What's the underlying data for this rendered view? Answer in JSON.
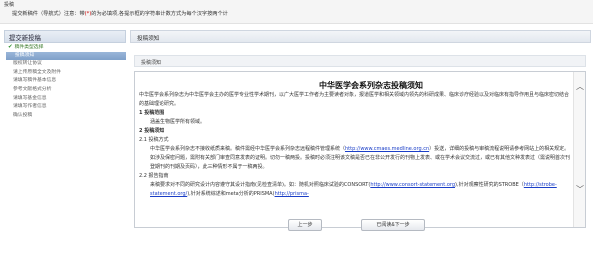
{
  "header": {
    "title": "投稿",
    "instruction_prefix": "提交新稿件（导航式）注意：带",
    "required_mark": "(*)",
    "instruction_suffix": "的为必填项,各提示框的字符串计数方式为每个汉字按两个计"
  },
  "sidebar": {
    "title": "提交新投稿",
    "items": [
      {
        "label": "稿件类型选择",
        "state": "done"
      },
      {
        "label": "投稿须知",
        "state": "active"
      },
      {
        "label": "版权转让协议",
        "state": "pending"
      },
      {
        "label": "请上传原稿全文及附件",
        "state": "pending"
      },
      {
        "label": "请填写稿件基本信息",
        "state": "pending"
      },
      {
        "label": "参考文献格式分析",
        "state": "pending"
      },
      {
        "label": "请填写基金信息",
        "state": "pending"
      },
      {
        "label": "请填写作者信息",
        "state": "pending"
      },
      {
        "label": "确认投稿",
        "state": "pending"
      }
    ]
  },
  "main": {
    "title": "投稿须知",
    "subtitle": "投稿须知"
  },
  "doc": {
    "title": "中华医学会系列杂志投稿须知",
    "intro": "中华医学会系列杂志为中华医学会主办的医学专业性学术期刊，以广大医学工作者为主要读者对象，报道医学和相关领域内领先的科研成果、临床诊疗经验以及对临床有指导作用且与临床密切结合的基础理论研究。",
    "s1_title": "1 投稿范围",
    "s1_body": "涵盖生物医学所有领域。",
    "s2_title": "2 投稿须知",
    "s21_title": "2.1 投稿方式",
    "s21_a": "中华医学会系列杂志不接收纸质来稿。稿件需经中华医学会系列杂志远程稿件管理系统（",
    "s21_link": "http://www.cmaes.medline.org.cn",
    "s21_b": "）投送，详细的投稿与审稿流程说明请参考网站上的相关规定。",
    "s21_c": "如涉及保密问题，需附有关部门审查同意发表的证明。切勿一稿两投。投稿时必须注明该文稿是否已在非公开发行的刊物上发表、或在学术会议交流过，或已有其他文种发表过（需说明首次刊登期刊的刊期及页码），此三种情形不属于一稿两投。",
    "s22_title": "2.2 报告指南",
    "s22_a": "来稿要求对不同的研究设计内容遵守其设计指南(见检查清单)。如：随机对照临床试验的CONSORT(",
    "s22_link1": "http://www.consort-statement.org",
    "s22_b": "),针对观察性研究的STROBE（",
    "s22_link2": "http://strobe-statement.org/",
    "s22_c": "),针对系统综述和meta分析的PRISMA(",
    "s22_link3": "http://prisma-"
  },
  "buttons": {
    "prev": "上一步",
    "next": "已阅读&下一步"
  },
  "icons": {
    "done": "check-icon",
    "scroll_up": "chevron-up-icon",
    "scroll_down": "chevron-down-icon"
  }
}
